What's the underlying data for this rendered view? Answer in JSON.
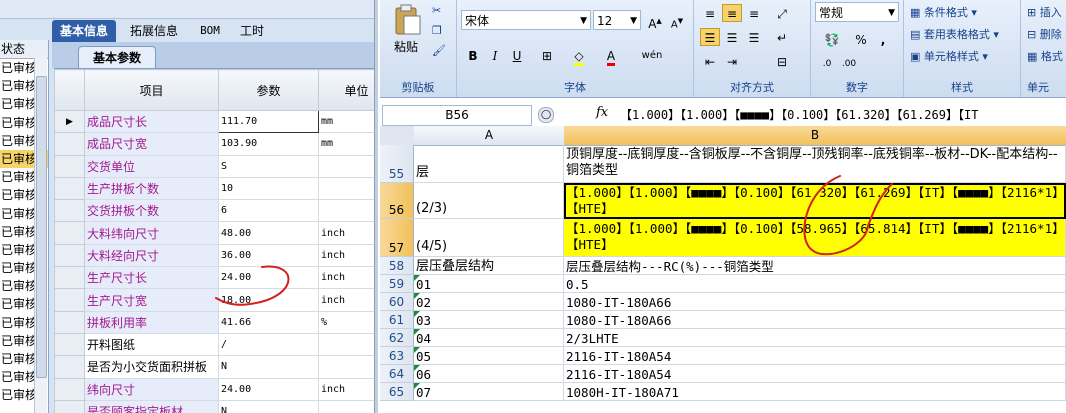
{
  "erp": {
    "status_header": "状态",
    "status_items": [
      "已审核",
      "已审核",
      "已审核",
      "已审核",
      "已审核",
      "已审核",
      "已审核",
      "已审核",
      "已审核",
      "已审核",
      "已审核",
      "已审核",
      "已审核",
      "已审核",
      "已审核",
      "已审核",
      "已审核",
      "已审核",
      "已审核"
    ],
    "tabs": [
      "基本信息",
      "拓展信息",
      "BOM",
      "工时"
    ],
    "subtab": "基本参数",
    "columns": [
      "项目",
      "参数",
      "单位"
    ],
    "rows": [
      {
        "name": "成品尺寸长",
        "value": "111.70",
        "unit": "mm",
        "color": "purple"
      },
      {
        "name": "成品尺寸宽",
        "value": "103.90",
        "unit": "mm",
        "color": "purple"
      },
      {
        "name": "交货单位",
        "value": "S",
        "unit": "",
        "color": "purple"
      },
      {
        "name": "生产拼板个数",
        "value": "10",
        "unit": "",
        "color": "purple"
      },
      {
        "name": "交货拼板个数",
        "value": "6",
        "unit": "",
        "color": "purple"
      },
      {
        "name": "大料纬向尺寸",
        "value": "48.00",
        "unit": "inch",
        "color": "purple"
      },
      {
        "name": "大料经向尺寸",
        "value": "36.00",
        "unit": "inch",
        "color": "purple"
      },
      {
        "name": "生产尺寸长",
        "value": "24.00",
        "unit": "inch",
        "color": "purple"
      },
      {
        "name": "生产尺寸宽",
        "value": "18.00",
        "unit": "inch",
        "color": "purple"
      },
      {
        "name": "拼板利用率",
        "value": "41.66",
        "unit": "%",
        "color": "purple"
      },
      {
        "name": "开料图纸",
        "value": "/",
        "unit": "",
        "color": "black"
      },
      {
        "name": "是否为小交货面积拼板",
        "value": "N",
        "unit": "",
        "color": "black"
      },
      {
        "name": "纬向尺寸",
        "value": "24.00",
        "unit": "inch",
        "color": "purple"
      },
      {
        "name": "是否顾客指定板材",
        "value": "N",
        "unit": "",
        "color": "purple"
      }
    ]
  },
  "excel": {
    "ribbon": {
      "clipboard_label": "剪贴板",
      "paste_label": "粘贴",
      "font_label": "字体",
      "font_name": "宋体",
      "font_size": "12",
      "align_label": "对齐方式",
      "number_label": "数字",
      "number_format": "常规",
      "styles_label": "样式",
      "cond_format": "条件格式",
      "table_format": "套用表格格式",
      "cell_style": "单元格样式",
      "cells_label": "单元",
      "insert": "插入",
      "delete": "删除",
      "format": "格式"
    },
    "name_box": "B56",
    "fx": "fx",
    "formula": "【1.000】【1.000】【■■■■】【0.100】【61.320】【61.269】【IT",
    "col_a": "A",
    "col_b": "B",
    "rows": [
      {
        "num": "55",
        "a": "层",
        "b": "顶铜厚度--底铜厚度--含铜板厚--不含铜厚--顶残铜率--底残铜率--板材--DK--配本结构--铜箔类型",
        "hl": false
      },
      {
        "num": "56",
        "a": "(2/3)",
        "b": "【1.000】【1.000】【■■■■】【0.100】【61.320】【61.269】【IT】【■■■■】【2116*1】【HTE】",
        "hl": true
      },
      {
        "num": "57",
        "a": "(4/5)",
        "b": "【1.000】【1.000】【■■■■】【0.100】【58.965】【65.814】【IT】【■■■■】【2116*1】【HTE】",
        "hl": true
      },
      {
        "num": "58",
        "a": "层压叠层结构",
        "b": "层压叠层结构---RC(%)---铜箔类型",
        "hl": false
      },
      {
        "num": "59",
        "a": "01",
        "b": "0.5",
        "hl": false
      },
      {
        "num": "60",
        "a": "02",
        "b": "1080-IT-180A66",
        "hl": false
      },
      {
        "num": "61",
        "a": "03",
        "b": "1080-IT-180A66",
        "hl": false
      },
      {
        "num": "62",
        "a": "04",
        "b": "2/3LHTE",
        "hl": false
      },
      {
        "num": "63",
        "a": "05",
        "b": "2116-IT-180A54",
        "hl": false
      },
      {
        "num": "64",
        "a": "06",
        "b": "2116-IT-180A54",
        "hl": false
      },
      {
        "num": "65",
        "a": "07",
        "b": "1080H-IT-180A71",
        "hl": false
      }
    ]
  },
  "colors": {
    "tab_active": "#2f5fa8",
    "purple_text": "#a3188c",
    "highlight": "#ffff00",
    "annotation": "#d42020"
  }
}
